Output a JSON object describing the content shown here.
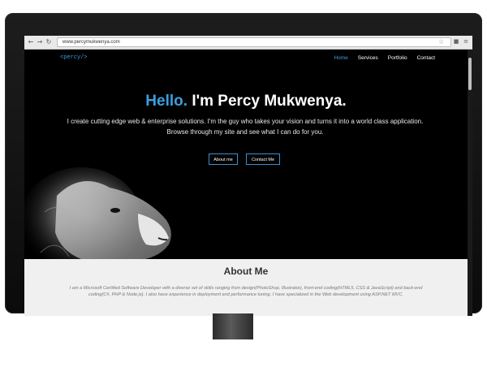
{
  "browser": {
    "back": "←",
    "forward": "→",
    "reload": "↻",
    "url": "www.percymukwenya.com",
    "star": "☆"
  },
  "site": {
    "logo": "<percy/>",
    "nav": [
      "Home",
      "Services",
      "Portfolio",
      "Contact"
    ],
    "active_nav": "Home",
    "hero": {
      "hello": "Hello.",
      "name": "I'm Percy Mukwenya.",
      "subtitle": "I create cutting edge web & enterprise solutions. I'm the guy who takes your vision and turns it into a world class application. Browse through my site and see what I can do for you.",
      "buttons": [
        "About me",
        "Contact Me"
      ]
    },
    "about": {
      "heading": "About Me",
      "text": "I am a Microsoft Certified Software Developer with a diverse set of skills ranging from design(PhotoShop, Illustrator), front-end coding(HTML5, CSS & JavaScript) and back-end coding(C#, PHP & Node.js). I also have experience in deployment and performance tuning. I have specialized in the Web development using ASP.NET MVC."
    }
  },
  "colors": {
    "accent": "#39a0e0",
    "hero_bg": "#000000",
    "about_bg": "#f0f0f0",
    "monitor_frame": "#111111"
  }
}
